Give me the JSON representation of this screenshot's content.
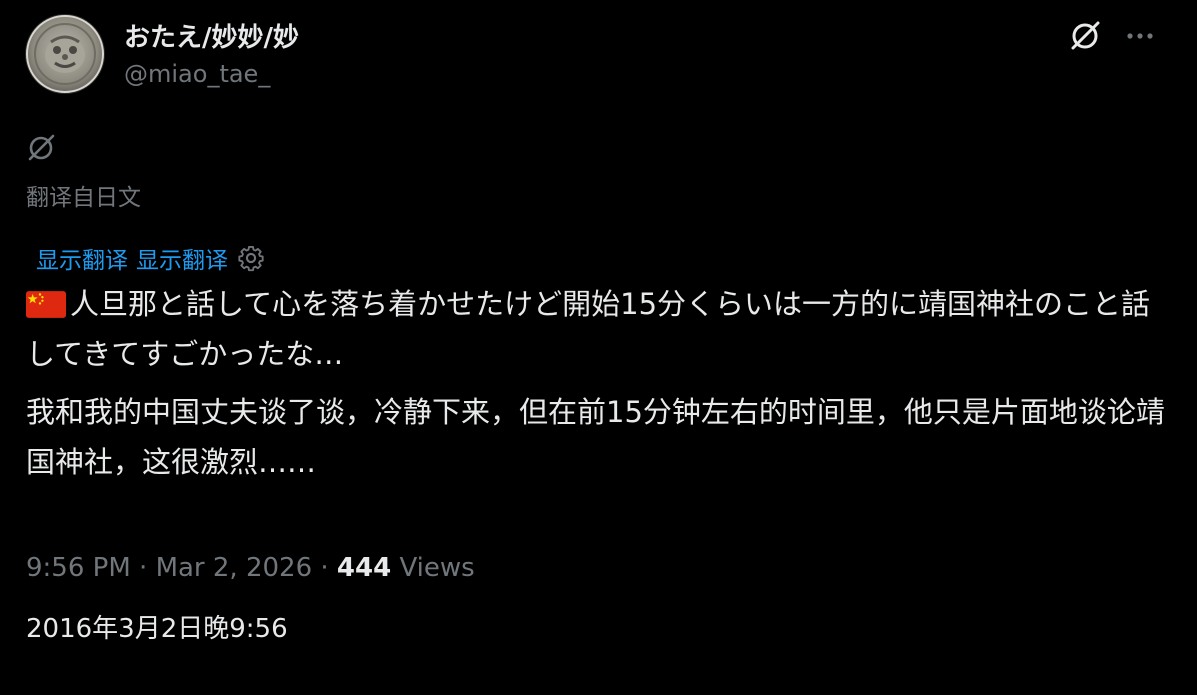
{
  "author": {
    "display_name": "おたえ/妙妙/妙",
    "handle": "@miao_tae_"
  },
  "icons": {
    "grok": "grok-icon",
    "more": "more-icon",
    "settings": "gear-icon",
    "flag": "china-flag-icon"
  },
  "translation": {
    "translated_from": "翻译自日文",
    "show_translation_1": "显示翻译",
    "show_translation_2": "显示翻译"
  },
  "post": {
    "original_text": "人旦那と話して心を落ち着かせたけど開始15分くらいは一方的に靖国神社のこと話してきてすごかったな…",
    "translated_text": "我和我的中国丈夫谈了谈，冷静下来，但在前15分钟左右的时间里，他只是片面地谈论靖国神社，这很激烈……"
  },
  "meta": {
    "time": "9:56 PM",
    "date": "Mar 2, 2026",
    "separator": " · ",
    "views_count": "444",
    "views_label": "Views",
    "translated_date": "2016年3月2日晚9:56"
  },
  "colors": {
    "background": "#000000",
    "text_primary": "#e7e9ea",
    "text_secondary": "#71767b",
    "link": "#1d9bf0"
  }
}
